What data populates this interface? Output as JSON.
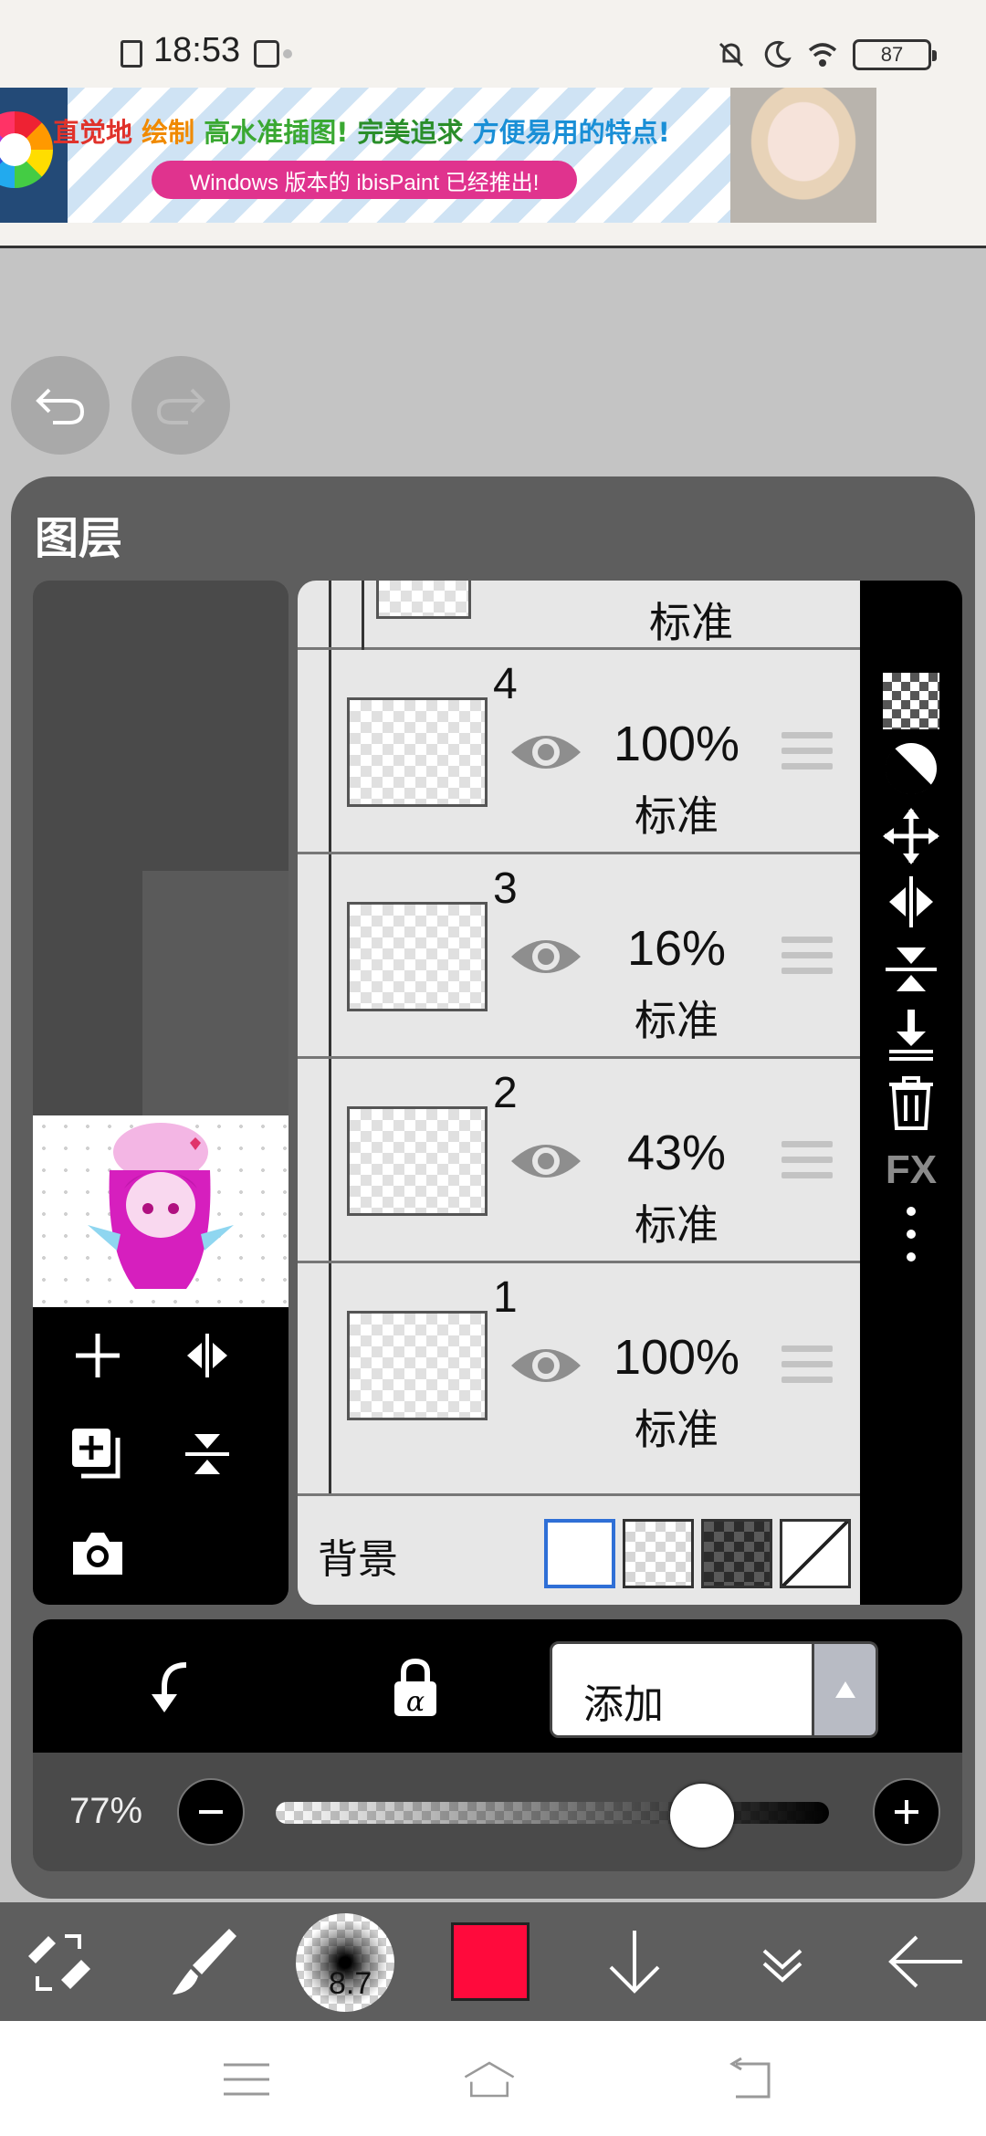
{
  "status_bar": {
    "time": "18:53",
    "battery": "87"
  },
  "banner": {
    "headline_parts": [
      {
        "text": "直觉地 ",
        "color": "#e0322b"
      },
      {
        "text": "绘制 ",
        "color": "#f08a00"
      },
      {
        "text": "高水准插图! ",
        "color": "#3aa832"
      },
      {
        "text": "完美追求 ",
        "color": "#2a8e2a"
      },
      {
        "text": "方便易用的特点!",
        "color": "#1a8fd6"
      }
    ],
    "subline": "Windows 版本的 ibisPaint 已经推出!"
  },
  "panel": {
    "title": "图层"
  },
  "layers": [
    {
      "number": "",
      "opacity": "",
      "blend": "标准"
    },
    {
      "number": "4",
      "opacity": "100%",
      "blend": "标准"
    },
    {
      "number": "3",
      "opacity": "16%",
      "blend": "标准"
    },
    {
      "number": "2",
      "opacity": "43%",
      "blend": "标准"
    },
    {
      "number": "1",
      "opacity": "100%",
      "blend": "标准"
    }
  ],
  "background": {
    "label": "背景"
  },
  "right_tools": {
    "fx_label": "FX"
  },
  "blend_mode": {
    "value": "添加"
  },
  "layer_opacity": {
    "label": "77%",
    "value": 0.77
  },
  "toolbar": {
    "brush_size": "8.7",
    "color": "#ff0a3c"
  }
}
